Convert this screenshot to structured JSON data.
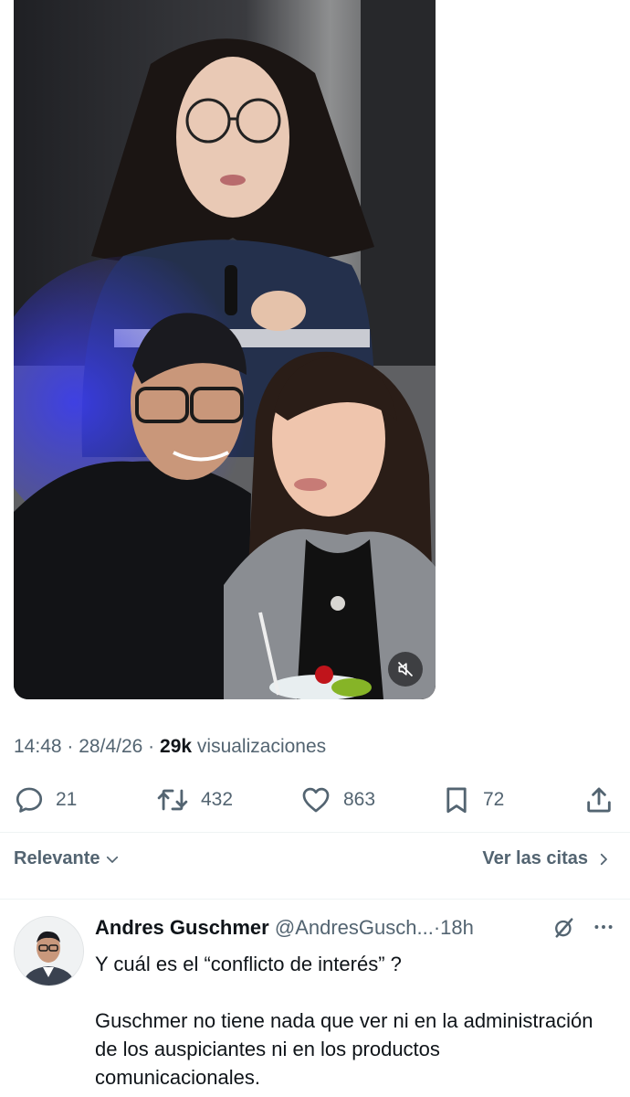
{
  "post": {
    "media": {
      "description_icon": "muted-speaker-icon"
    },
    "time": "14:48",
    "separator": "·",
    "date": "28/4/26",
    "views_count": "29k",
    "views_label": "visualizaciones",
    "actions": {
      "replies": "21",
      "reposts": "432",
      "likes": "863",
      "bookmarks": "72"
    }
  },
  "sort": {
    "label": "Relevante",
    "quotes_label": "Ver las citas"
  },
  "reply": {
    "name": "Andres Guschmer",
    "handle": "@AndresGusch...",
    "separator": "·",
    "time": "18h",
    "text_line1": "Y cuál es el “conflicto de interés” ?",
    "text_para2": "Guschmer no tiene nada que ver ni en la administración de los auspiciantes ni en los productos comunicacionales."
  },
  "colors": {
    "text_primary": "#0f1419",
    "text_secondary": "#536471",
    "divider": "#eff3f4"
  }
}
